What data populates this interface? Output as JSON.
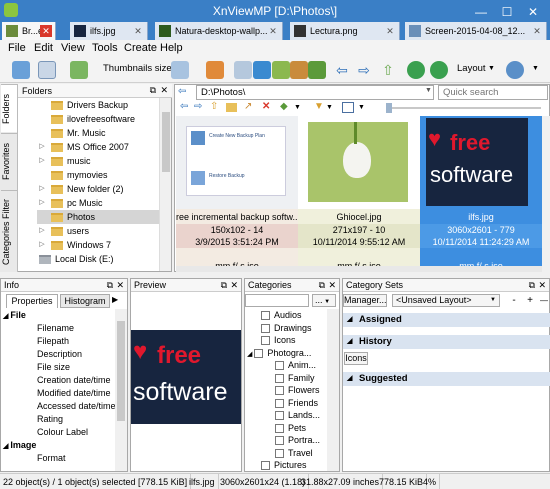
{
  "window": {
    "title": "XnViewMP [D:\\Photos\\]"
  },
  "tabs": [
    {
      "label": "Br...er",
      "close": "✕"
    },
    {
      "label": "ilfs.jpg",
      "close": "✕"
    },
    {
      "label": "Natura-desktop-wallp...",
      "close": "✕"
    },
    {
      "label": "Lectura.png",
      "close": "✕"
    },
    {
      "label": "Screen-2015-04-08_12...",
      "close": "✕"
    }
  ],
  "menu": [
    "File",
    "Edit",
    "View",
    "Tools",
    "Create",
    "Help"
  ],
  "toolbar": {
    "thumbnails_label": "Thumbnails size",
    "layout_label": "Layout"
  },
  "folders": {
    "header": "Folders",
    "side_tabs": [
      "Folders",
      "Favorites",
      "Categories Filter"
    ],
    "items": [
      {
        "label": "Drivers Backup",
        "arrow": ""
      },
      {
        "label": "ilovefreesoftware",
        "arrow": ""
      },
      {
        "label": "Mr. Music",
        "arrow": ""
      },
      {
        "label": "MS Office 2007",
        "arrow": "▷"
      },
      {
        "label": "music",
        "arrow": "▷"
      },
      {
        "label": "mymovies",
        "arrow": ""
      },
      {
        "label": "New folder (2)",
        "arrow": "▷"
      },
      {
        "label": "pc Music",
        "arrow": "▷"
      },
      {
        "label": "Photos",
        "arrow": ""
      },
      {
        "label": "users",
        "arrow": "▷"
      },
      {
        "label": "Windows 7",
        "arrow": "▷"
      },
      {
        "label": "Local Disk (E:)",
        "arrow": "▷"
      }
    ]
  },
  "browser": {
    "path": "D:\\Photos\\",
    "search_placeholder": "Quick search",
    "thumbs": [
      {
        "name": "ree incremental backup softw...",
        "dims": "150x102 - 14",
        "date": "3/9/2015 3:51:24 PM",
        "exif": "mm f/ s iso",
        "img_text_1": "Create New Backup Plan",
        "img_text_2": "Restore Backup"
      },
      {
        "name": "Ghiocel.jpg",
        "dims": "271x197 - 10",
        "date": "10/11/2014 9:55:12 AM",
        "exif": "mm f/ s iso"
      },
      {
        "name": "ilfs.jpg",
        "dims": "3060x2601 - 779",
        "date": "10/11/2014 11:24:29 AM",
        "exif": "mm f/ s iso",
        "logo_1": "free",
        "logo_2": "software"
      }
    ]
  },
  "info": {
    "header": "Info",
    "tabs": [
      "Properties",
      "Histogram"
    ],
    "rows": [
      {
        "text": "File",
        "section": true
      },
      {
        "text": "Filename"
      },
      {
        "text": "Filepath"
      },
      {
        "text": "Description"
      },
      {
        "text": "File size"
      },
      {
        "text": "Creation date/time"
      },
      {
        "text": "Modified date/time"
      },
      {
        "text": "Accessed date/time"
      },
      {
        "text": "Rating"
      },
      {
        "text": "Colour Label"
      },
      {
        "text": "Image",
        "section": true
      },
      {
        "text": "Format"
      }
    ]
  },
  "preview": {
    "header": "Preview",
    "logo_1": "free",
    "logo_2": "software"
  },
  "categories": {
    "header": "Categories",
    "items": [
      {
        "label": "Audios",
        "indent": 1
      },
      {
        "label": "Drawings",
        "indent": 1
      },
      {
        "label": "Icons",
        "indent": 1
      },
      {
        "label": "Photogra...",
        "indent": 0,
        "arrow": "◢"
      },
      {
        "label": "Anim...",
        "indent": 2
      },
      {
        "label": "Family",
        "indent": 2
      },
      {
        "label": "Flowers",
        "indent": 2
      },
      {
        "label": "Friends",
        "indent": 2
      },
      {
        "label": "Lands...",
        "indent": 2
      },
      {
        "label": "Pets",
        "indent": 2
      },
      {
        "label": "Portra...",
        "indent": 2
      },
      {
        "label": "Travel",
        "indent": 2
      },
      {
        "label": "Pictures",
        "indent": 1
      }
    ],
    "more_button": "..."
  },
  "category_sets": {
    "header": "Category Sets",
    "manager_button": "Manager...",
    "layout_select": "<Unsaved Layout>",
    "sections": {
      "assigned": "Assigned",
      "history": "History",
      "suggested": "Suggested"
    },
    "history_items": [
      "Icons"
    ]
  },
  "status": {
    "objects": "22 object(s) / 1 object(s) selected [778.15 KiB]",
    "file": "ilfs.jpg",
    "dims": "3060x2601x24 (1.18)",
    "inches": "31.88x27.09 inches",
    "size": "778.15 KiB",
    "zoom": "4%"
  },
  "colors": {
    "accent": "#3a7fc6",
    "selection": "#3d8ee0",
    "logo_red": "#e0182d",
    "logo_bg": "#17253f"
  }
}
